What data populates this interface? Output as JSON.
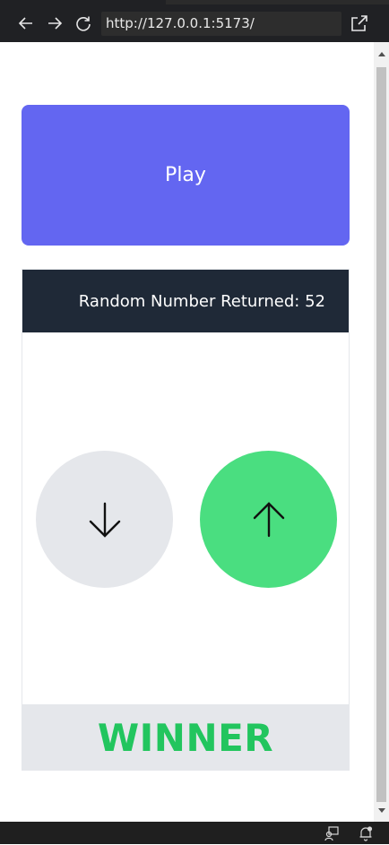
{
  "browser": {
    "url": "http://127.0.0.1:5173/",
    "icons": [
      "back-arrow-icon",
      "forward-arrow-icon",
      "reload-icon",
      "open-external-icon"
    ]
  },
  "game": {
    "play_label": "Play",
    "result_label": "Random Number Returned: 52",
    "guess_buttons": [
      {
        "icon": "arrow-down-icon",
        "color": "#e5e7eb",
        "selected": false
      },
      {
        "icon": "arrow-up-icon",
        "color": "#4ade80",
        "selected": true
      }
    ],
    "outcome": "WINNER"
  },
  "colors": {
    "play_button": "#6366f1",
    "result_bar": "#1f2937",
    "winner_text": "#22c55e",
    "winner_bar": "#e5e7eb"
  },
  "status_bar": {
    "icons": [
      "remote-session-icon",
      "notification-bell-icon"
    ]
  }
}
